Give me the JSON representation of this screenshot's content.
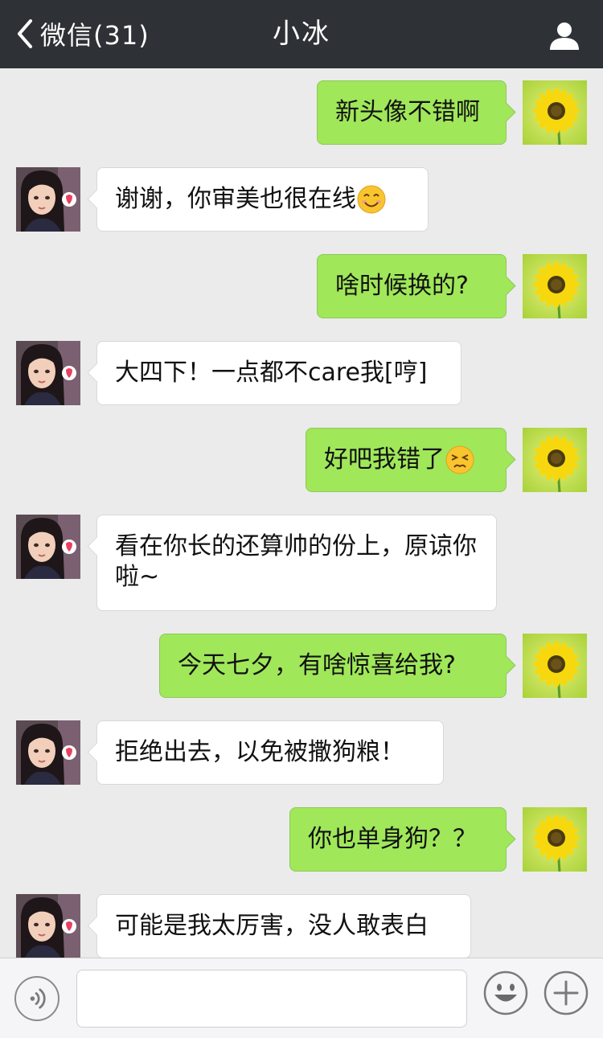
{
  "header": {
    "back_label": "微信(31)",
    "title": "小冰"
  },
  "messages": [
    {
      "side": "right",
      "text": "新头像不错啊"
    },
    {
      "side": "left",
      "text": "谢谢，你审美也很在线",
      "emoji": "smile-emoji"
    },
    {
      "side": "right",
      "text": "啥时候换的?"
    },
    {
      "side": "left",
      "text": "大四下！一点都不care我[哼]"
    },
    {
      "side": "right",
      "text": "好吧我错了",
      "emoji": "persevering-emoji"
    },
    {
      "side": "left",
      "text": "看在你长的还算帅的份上，原谅你啦~"
    },
    {
      "side": "right",
      "text": "今天七夕，有啥惊喜给我?"
    },
    {
      "side": "left",
      "text": "拒绝出去，以免被撒狗粮！"
    },
    {
      "side": "right",
      "text": "你也单身狗？？"
    },
    {
      "side": "left",
      "text": "可能是我太厉害，没人敢表白"
    }
  ],
  "input": {
    "value": "",
    "placeholder": ""
  },
  "colors": {
    "header_bg": "#2e3135",
    "chat_bg": "#ebebeb",
    "sent_bubble": "#a0e75a",
    "received_bubble": "#ffffff"
  },
  "icons": {
    "back": "chevron-left-icon",
    "profile": "person-icon",
    "voice": "voice-icon",
    "emoji": "emoji-face-icon",
    "more": "plus-icon"
  }
}
